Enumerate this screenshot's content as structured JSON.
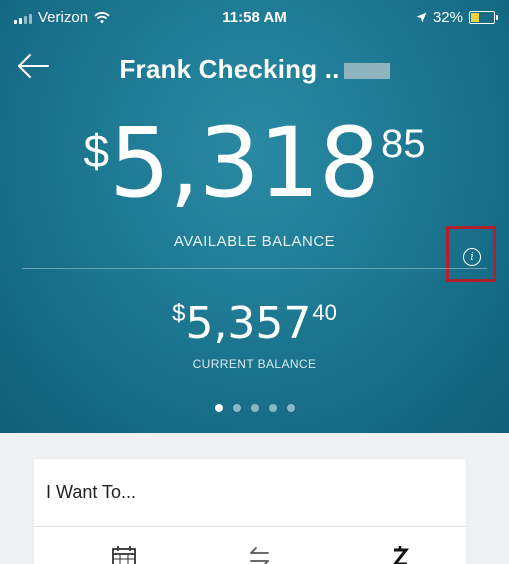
{
  "status_bar": {
    "carrier": "Verizon",
    "time": "11:58 AM",
    "battery_text": "32%",
    "battery_level": 0.32,
    "battery_color": "#f4d23b"
  },
  "nav": {
    "title": "Frank Checking ..",
    "back_icon": "arrow-left-icon"
  },
  "available": {
    "currency": "$",
    "whole": "5,318",
    "cents": "85",
    "label": "AVAILABLE BALANCE"
  },
  "current": {
    "currency": "$",
    "whole": "5,357",
    "cents": "40",
    "label": "CURRENT BALANCE"
  },
  "info": {
    "glyph": "i",
    "highlight_color": "#b21f2d"
  },
  "pager": {
    "count": 5,
    "active_index": 0
  },
  "want_to": {
    "title": "I Want To...",
    "actions": [
      "calendar-icon",
      "transfer-arrows-icon",
      "zelle-icon"
    ]
  },
  "colors": {
    "hero": "#1f7a94",
    "accent_highlight": "#b21f2d"
  }
}
